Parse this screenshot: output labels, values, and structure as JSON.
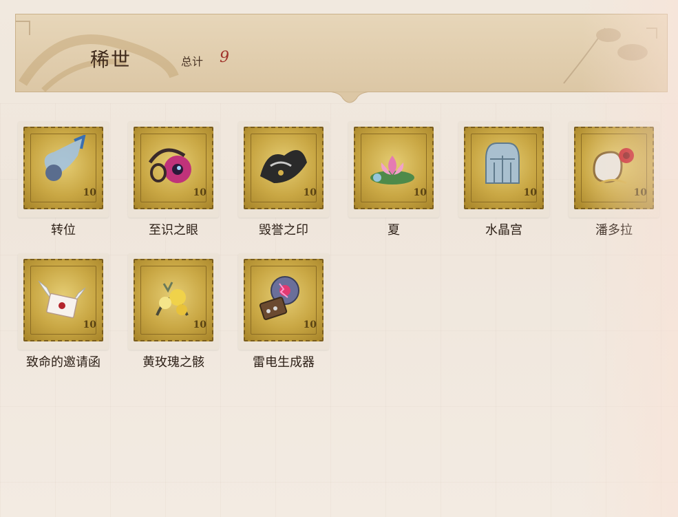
{
  "header": {
    "title": "稀世",
    "total_label": "总计",
    "total_value": "9"
  },
  "items": [
    {
      "label": "转位",
      "stamp_value": "10",
      "icon": "lock-icon"
    },
    {
      "label": "至识之眼",
      "stamp_value": "10",
      "icon": "eye-icon"
    },
    {
      "label": "毁誉之印",
      "stamp_value": "10",
      "icon": "dark-seal-icon"
    },
    {
      "label": "夏",
      "stamp_value": "10",
      "icon": "lotus-icon"
    },
    {
      "label": "水晶宫",
      "stamp_value": "10",
      "icon": "crystal-palace-icon"
    },
    {
      "label": "潘多拉",
      "stamp_value": "10",
      "icon": "rose-box-icon"
    },
    {
      "label": "致命的邀请函",
      "stamp_value": "10",
      "icon": "winged-envelope-icon"
    },
    {
      "label": "黄玫瑰之骸",
      "stamp_value": "10",
      "icon": "yellow-rose-icon"
    },
    {
      "label": "雷电生成器",
      "stamp_value": "10",
      "icon": "lightning-orb-icon"
    }
  ],
  "colors": {
    "accent": "#a0322a",
    "stamp_gold": "#c9a744"
  }
}
